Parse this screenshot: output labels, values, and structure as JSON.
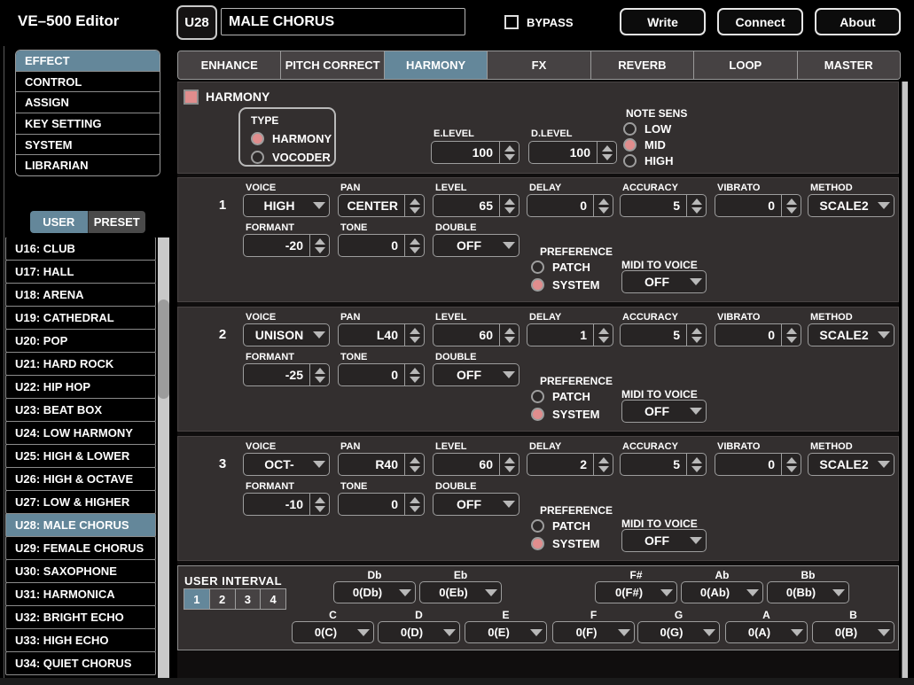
{
  "app": {
    "title": "VE–500 Editor"
  },
  "header": {
    "patch_number": "U28",
    "patch_name": "MALE CHORUS",
    "bypass_label": "BYPASS",
    "write_label": "Write",
    "connect_label": "Connect",
    "about_label": "About"
  },
  "sidebar": {
    "nav": [
      {
        "label": "EFFECT",
        "selected": true
      },
      {
        "label": "CONTROL"
      },
      {
        "label": "ASSIGN"
      },
      {
        "label": "KEY SETTING"
      },
      {
        "label": "SYSTEM"
      },
      {
        "label": "LIBRARIAN"
      }
    ],
    "list_tabs": [
      {
        "label": "USER",
        "selected": true
      },
      {
        "label": "PRESET"
      }
    ],
    "patches": [
      {
        "label": "U16: CLUB"
      },
      {
        "label": "U17: HALL"
      },
      {
        "label": "U18: ARENA"
      },
      {
        "label": "U19: CATHEDRAL"
      },
      {
        "label": "U20: POP"
      },
      {
        "label": "U21: HARD ROCK"
      },
      {
        "label": "U22: HIP HOP"
      },
      {
        "label": "U23: BEAT BOX"
      },
      {
        "label": "U24: LOW HARMONY"
      },
      {
        "label": "U25: HIGH & LOWER"
      },
      {
        "label": "U26: HIGH & OCTAVE"
      },
      {
        "label": "U27: LOW & HIGHER"
      },
      {
        "label": "U28: MALE CHORUS",
        "selected": true
      },
      {
        "label": "U29: FEMALE CHORUS"
      },
      {
        "label": "U30: SAXOPHONE"
      },
      {
        "label": "U31: HARMONICA"
      },
      {
        "label": "U32: BRIGHT ECHO"
      },
      {
        "label": "U33: HIGH ECHO"
      },
      {
        "label": "U34: QUIET CHORUS"
      }
    ]
  },
  "tabs": [
    {
      "label": "ENHANCE"
    },
    {
      "label": "PITCH CORRECT"
    },
    {
      "label": "HARMONY",
      "selected": true
    },
    {
      "label": "FX"
    },
    {
      "label": "REVERB"
    },
    {
      "label": "LOOP"
    },
    {
      "label": "MASTER"
    }
  ],
  "harmony": {
    "title": "HARMONY",
    "type_label": "TYPE",
    "type_options": [
      {
        "label": "HARMONY",
        "selected": true
      },
      {
        "label": "VOCODER"
      }
    ],
    "e_level_label": "E.LEVEL",
    "e_level": "100",
    "d_level_label": "D.LEVEL",
    "d_level": "100",
    "note_sens_label": "NOTE SENS",
    "note_sens_options": [
      {
        "label": "LOW"
      },
      {
        "label": "MID",
        "selected": true
      },
      {
        "label": "HIGH"
      }
    ]
  },
  "labels": {
    "voice": "VOICE",
    "pan": "PAN",
    "level": "LEVEL",
    "delay": "DELAY",
    "accuracy": "ACCURACY",
    "vibrato": "VIBRATO",
    "method": "METHOD",
    "formant": "FORMANT",
    "tone": "TONE",
    "double": "DOUBLE",
    "preference": "PREFERENCE",
    "patch": "PATCH",
    "system": "SYSTEM",
    "midi_to_voice": "MIDI TO VOICE"
  },
  "voices": [
    {
      "number": "1",
      "voice": "HIGH",
      "pan": "CENTER",
      "level": "65",
      "delay": "0",
      "accuracy": "5",
      "vibrato": "0",
      "method": "SCALE2",
      "formant": "-20",
      "tone": "0",
      "double": "OFF",
      "preference": "SYSTEM",
      "midi_to_voice": "OFF"
    },
    {
      "number": "2",
      "voice": "UNISON",
      "pan": "L40",
      "level": "60",
      "delay": "1",
      "accuracy": "5",
      "vibrato": "0",
      "method": "SCALE2",
      "formant": "-25",
      "tone": "0",
      "double": "OFF",
      "preference": "SYSTEM",
      "midi_to_voice": "OFF"
    },
    {
      "number": "3",
      "voice": "OCT-",
      "pan": "R40",
      "level": "60",
      "delay": "2",
      "accuracy": "5",
      "vibrato": "0",
      "method": "SCALE2",
      "formant": "-10",
      "tone": "0",
      "double": "OFF",
      "preference": "SYSTEM",
      "midi_to_voice": "OFF"
    }
  ],
  "user_interval": {
    "label": "USER INTERVAL",
    "buttons": [
      {
        "label": "1",
        "selected": true
      },
      {
        "label": "2"
      },
      {
        "label": "3"
      },
      {
        "label": "4"
      }
    ],
    "top_row": [
      {
        "note": "Db",
        "value": "0(Db)"
      },
      {
        "note": "Eb",
        "value": "0(Eb)"
      },
      {
        "note": "F#",
        "value": "0(F#)"
      },
      {
        "note": "Ab",
        "value": "0(Ab)"
      },
      {
        "note": "Bb",
        "value": "0(Bb)"
      }
    ],
    "bottom_row": [
      {
        "note": "C",
        "value": "0(C)"
      },
      {
        "note": "D",
        "value": "0(D)"
      },
      {
        "note": "E",
        "value": "0(E)"
      },
      {
        "note": "F",
        "value": "0(F)"
      },
      {
        "note": "G",
        "value": "0(G)"
      },
      {
        "note": "A",
        "value": "0(A)"
      },
      {
        "note": "B",
        "value": "0(B)"
      }
    ]
  },
  "colors": {
    "accent_blue": "#64879a",
    "radio_pink": "#e08d8d",
    "panel_bg": "#332f2f"
  }
}
